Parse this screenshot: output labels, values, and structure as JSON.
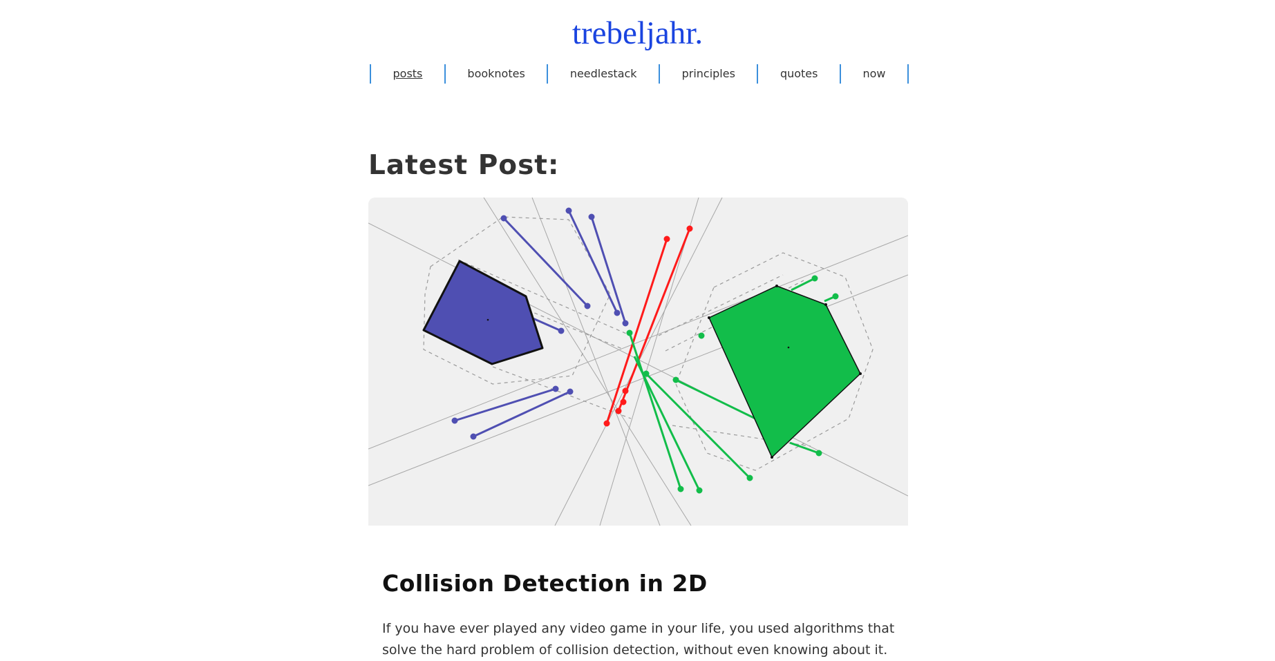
{
  "site": {
    "title": "trebeljahr."
  },
  "nav": {
    "items": [
      {
        "label": "posts",
        "current": true
      },
      {
        "label": "booknotes",
        "current": false
      },
      {
        "label": "needlestack",
        "current": false
      },
      {
        "label": "principles",
        "current": false
      },
      {
        "label": "quotes",
        "current": false
      },
      {
        "label": "now",
        "current": false
      }
    ]
  },
  "latest": {
    "heading": "Latest Post:",
    "post_title": "Collision Detection in 2D",
    "excerpt": "If you have ever played any video game in your life, you used algorithms that solve the hard problem of collision detection, without even knowing about it."
  },
  "colors": {
    "title_link": "#1a44e0",
    "nav_separator": "#3b8fdc",
    "polygon_blue": "#4f4fb2",
    "polygon_green": "#12bd4a",
    "projection_red": "#ff1a1a",
    "hero_background": "#f0f0f0"
  }
}
